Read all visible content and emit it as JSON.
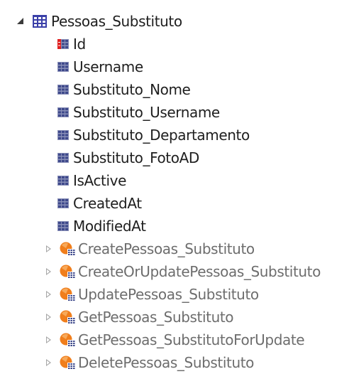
{
  "tree": {
    "root": {
      "label": "Pessoas_Substituto",
      "icon": "table-icon",
      "expanded": true
    },
    "fields": [
      {
        "label": "Id",
        "icon": "key-field-icon"
      },
      {
        "label": "Username",
        "icon": "field-icon"
      },
      {
        "label": "Substituto_Nome",
        "icon": "field-icon"
      },
      {
        "label": "Substituto_Username",
        "icon": "field-icon"
      },
      {
        "label": "Substituto_Departamento",
        "icon": "field-icon"
      },
      {
        "label": "Substituto_FotoAD",
        "icon": "field-icon"
      },
      {
        "label": "IsActive",
        "icon": "field-icon"
      },
      {
        "label": "CreatedAt",
        "icon": "field-icon"
      },
      {
        "label": "ModifiedAt",
        "icon": "field-icon"
      }
    ],
    "methods": [
      {
        "label": "CreatePessoas_Substituto",
        "icon": "method-icon",
        "expanded": false
      },
      {
        "label": "CreateOrUpdatePessoas_Substituto",
        "icon": "method-icon",
        "expanded": false
      },
      {
        "label": "UpdatePessoas_Substituto",
        "icon": "method-icon",
        "expanded": false
      },
      {
        "label": "GetPessoas_Substituto",
        "icon": "method-icon",
        "expanded": false
      },
      {
        "label": "GetPessoas_SubstitutoForUpdate",
        "icon": "method-icon",
        "expanded": false
      },
      {
        "label": "DeletePessoas_Substituto",
        "icon": "method-icon",
        "expanded": false
      }
    ]
  },
  "colors": {
    "table_icon": "#3a3fa8",
    "field_icon": "#3f4a8c",
    "key_marker": "#e02020",
    "method_orange": "#f07e1c",
    "method_text": "#6d6d6d"
  }
}
